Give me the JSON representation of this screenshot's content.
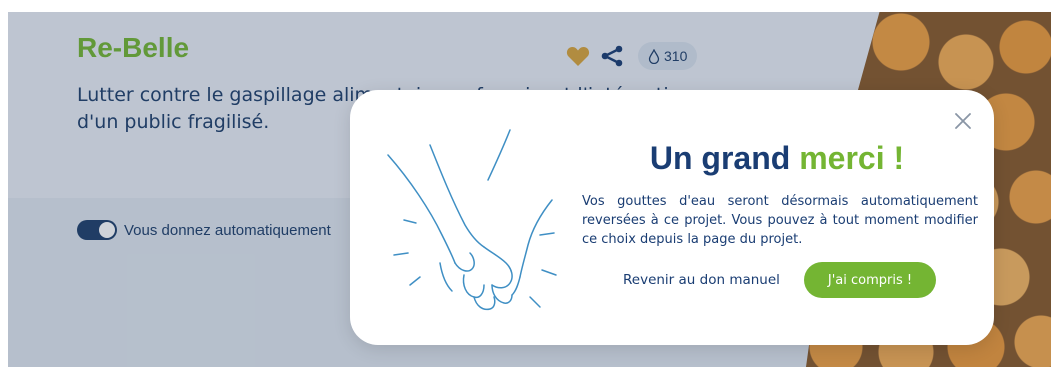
{
  "project": {
    "title": "Re-Belle",
    "description": "Lutter contre le gaspillage alimentaire en favorisant l'intégration d'un public fragilisé.",
    "drops_count": "310",
    "auto_donation_label": "Vous donnez automatiquement"
  },
  "modal": {
    "title_main": "Un grand",
    "title_accent": "merci !",
    "text": "Vos gouttes d'eau seront désormais automatiquement reversées à ce projet. Vous pouvez à tout moment modifier ce choix depuis la page du projet.",
    "manual_link_label": "Revenir au don manuel",
    "confirm_label": "J'ai compris !"
  },
  "icons": [
    "heart-icon",
    "share-icon",
    "drop-icon",
    "close-icon",
    "holding-hands-illustration"
  ],
  "colors": {
    "brand_green": "#74b533",
    "brand_navy": "#1a3d73",
    "heart_gold": "#d9a43b",
    "overlay": "rgba(38,55,80,0.22)"
  }
}
